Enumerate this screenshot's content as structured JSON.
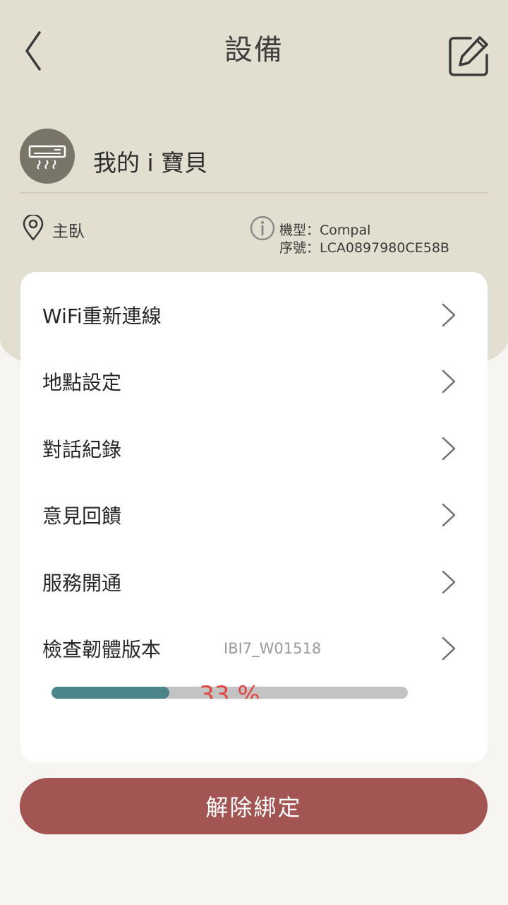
{
  "header": {
    "title": "設備",
    "back_icon": "chevron-left-icon",
    "edit_icon": "edit-icon"
  },
  "device": {
    "name": "我的 i 寶貝",
    "icon": "air-conditioner-icon",
    "location_icon": "location-pin-icon",
    "location": "主臥",
    "info_icon": "info-icon",
    "model_line": "機型：Compal",
    "serial_line": "序號：LCA0897980CE58B"
  },
  "menu": {
    "items": [
      {
        "label": "WiFi重新連線"
      },
      {
        "label": "地點設定"
      },
      {
        "label": "對話紀錄"
      },
      {
        "label": "意見回饋"
      },
      {
        "label": "服務開通"
      },
      {
        "label": "檢查韌體版本",
        "value": "IBI7_W01518"
      }
    ],
    "chevron_icon": "chevron-right-icon"
  },
  "firmware_progress": {
    "percent_text": "33 %",
    "fraction": 0.33
  },
  "unbind_button": {
    "label": "解除綁定"
  },
  "colors": {
    "header_bg": "#e2ded0",
    "page_bg": "#f6f5f1",
    "progress_fill": "#4b858a",
    "progress_text": "#e2453f",
    "unbind_button": "#a35553"
  }
}
